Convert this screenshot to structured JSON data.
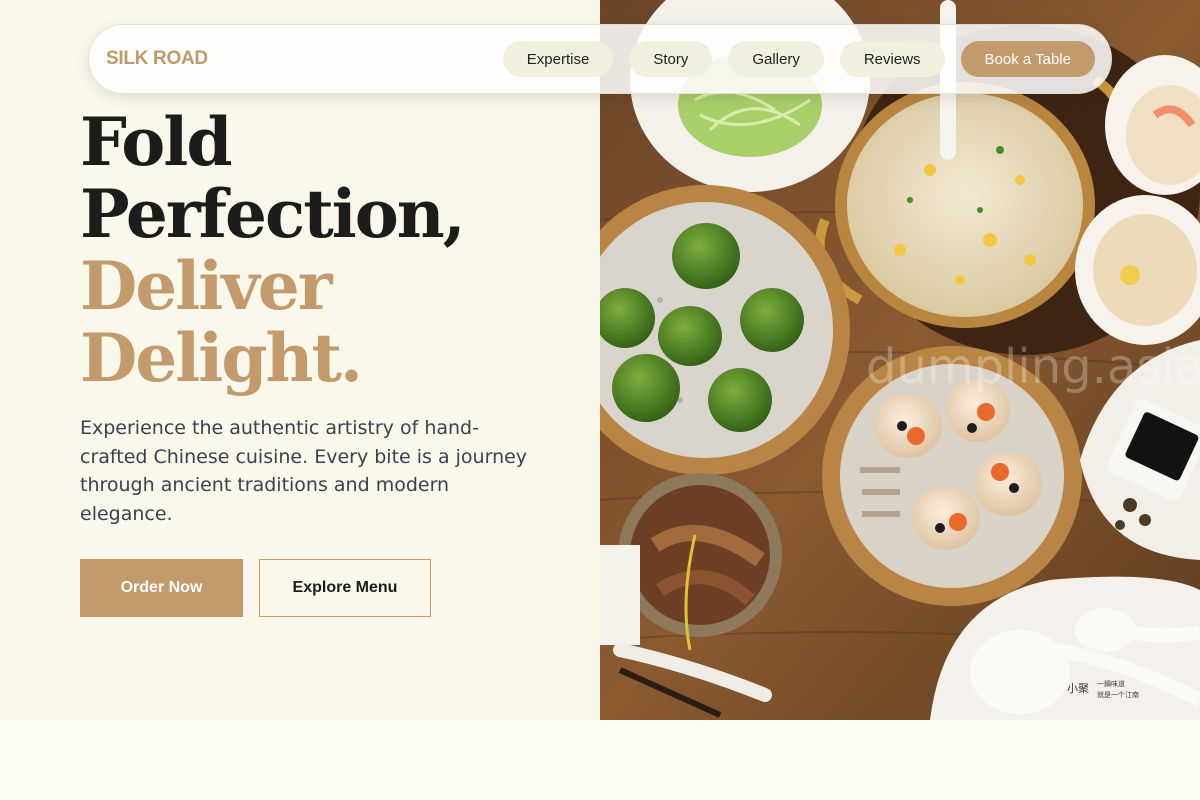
{
  "brand": {
    "name": "SILK ROAD"
  },
  "nav": {
    "links": [
      "Expertise",
      "Story",
      "Gallery",
      "Reviews"
    ],
    "cta": "Book a Table"
  },
  "hero": {
    "headline_line1": "Fold",
    "headline_line2": "Perfection,",
    "headline_line3": "Deliver",
    "headline_line4": "Delight.",
    "subtitle": "Experience the authentic artistry of hand-crafted Chinese cuisine. Every bite is a journey through ancient traditions and modern elegance.",
    "primary_button": "Order Now",
    "secondary_button": "Explore Menu"
  },
  "image": {
    "watermark": "dumpling.asia",
    "label_cn": "小聚",
    "sticker_text_1": "一鍋味道",
    "sticker_text_2": "就是一个江南"
  },
  "colors": {
    "accent": "#c29a6c",
    "background": "#faf8ea",
    "text_dark": "#1c1c1c",
    "text_muted": "#3a4150",
    "nav_pill": "#f1f0de"
  }
}
